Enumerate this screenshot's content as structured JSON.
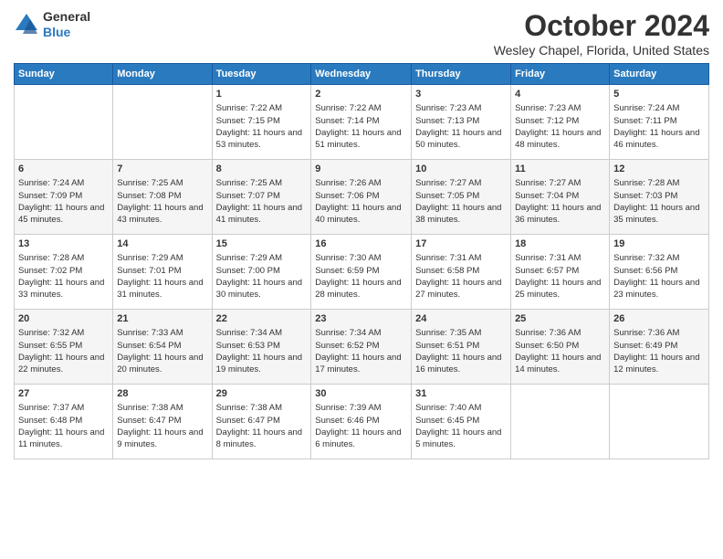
{
  "header": {
    "logo_line1": "General",
    "logo_line2": "Blue",
    "title": "October 2024",
    "location": "Wesley Chapel, Florida, United States"
  },
  "days_of_week": [
    "Sunday",
    "Monday",
    "Tuesday",
    "Wednesday",
    "Thursday",
    "Friday",
    "Saturday"
  ],
  "weeks": [
    [
      {
        "day": "",
        "data": ""
      },
      {
        "day": "",
        "data": ""
      },
      {
        "day": "1",
        "data": "Sunrise: 7:22 AM\nSunset: 7:15 PM\nDaylight: 11 hours and 53 minutes."
      },
      {
        "day": "2",
        "data": "Sunrise: 7:22 AM\nSunset: 7:14 PM\nDaylight: 11 hours and 51 minutes."
      },
      {
        "day": "3",
        "data": "Sunrise: 7:23 AM\nSunset: 7:13 PM\nDaylight: 11 hours and 50 minutes."
      },
      {
        "day": "4",
        "data": "Sunrise: 7:23 AM\nSunset: 7:12 PM\nDaylight: 11 hours and 48 minutes."
      },
      {
        "day": "5",
        "data": "Sunrise: 7:24 AM\nSunset: 7:11 PM\nDaylight: 11 hours and 46 minutes."
      }
    ],
    [
      {
        "day": "6",
        "data": "Sunrise: 7:24 AM\nSunset: 7:09 PM\nDaylight: 11 hours and 45 minutes."
      },
      {
        "day": "7",
        "data": "Sunrise: 7:25 AM\nSunset: 7:08 PM\nDaylight: 11 hours and 43 minutes."
      },
      {
        "day": "8",
        "data": "Sunrise: 7:25 AM\nSunset: 7:07 PM\nDaylight: 11 hours and 41 minutes."
      },
      {
        "day": "9",
        "data": "Sunrise: 7:26 AM\nSunset: 7:06 PM\nDaylight: 11 hours and 40 minutes."
      },
      {
        "day": "10",
        "data": "Sunrise: 7:27 AM\nSunset: 7:05 PM\nDaylight: 11 hours and 38 minutes."
      },
      {
        "day": "11",
        "data": "Sunrise: 7:27 AM\nSunset: 7:04 PM\nDaylight: 11 hours and 36 minutes."
      },
      {
        "day": "12",
        "data": "Sunrise: 7:28 AM\nSunset: 7:03 PM\nDaylight: 11 hours and 35 minutes."
      }
    ],
    [
      {
        "day": "13",
        "data": "Sunrise: 7:28 AM\nSunset: 7:02 PM\nDaylight: 11 hours and 33 minutes."
      },
      {
        "day": "14",
        "data": "Sunrise: 7:29 AM\nSunset: 7:01 PM\nDaylight: 11 hours and 31 minutes."
      },
      {
        "day": "15",
        "data": "Sunrise: 7:29 AM\nSunset: 7:00 PM\nDaylight: 11 hours and 30 minutes."
      },
      {
        "day": "16",
        "data": "Sunrise: 7:30 AM\nSunset: 6:59 PM\nDaylight: 11 hours and 28 minutes."
      },
      {
        "day": "17",
        "data": "Sunrise: 7:31 AM\nSunset: 6:58 PM\nDaylight: 11 hours and 27 minutes."
      },
      {
        "day": "18",
        "data": "Sunrise: 7:31 AM\nSunset: 6:57 PM\nDaylight: 11 hours and 25 minutes."
      },
      {
        "day": "19",
        "data": "Sunrise: 7:32 AM\nSunset: 6:56 PM\nDaylight: 11 hours and 23 minutes."
      }
    ],
    [
      {
        "day": "20",
        "data": "Sunrise: 7:32 AM\nSunset: 6:55 PM\nDaylight: 11 hours and 22 minutes."
      },
      {
        "day": "21",
        "data": "Sunrise: 7:33 AM\nSunset: 6:54 PM\nDaylight: 11 hours and 20 minutes."
      },
      {
        "day": "22",
        "data": "Sunrise: 7:34 AM\nSunset: 6:53 PM\nDaylight: 11 hours and 19 minutes."
      },
      {
        "day": "23",
        "data": "Sunrise: 7:34 AM\nSunset: 6:52 PM\nDaylight: 11 hours and 17 minutes."
      },
      {
        "day": "24",
        "data": "Sunrise: 7:35 AM\nSunset: 6:51 PM\nDaylight: 11 hours and 16 minutes."
      },
      {
        "day": "25",
        "data": "Sunrise: 7:36 AM\nSunset: 6:50 PM\nDaylight: 11 hours and 14 minutes."
      },
      {
        "day": "26",
        "data": "Sunrise: 7:36 AM\nSunset: 6:49 PM\nDaylight: 11 hours and 12 minutes."
      }
    ],
    [
      {
        "day": "27",
        "data": "Sunrise: 7:37 AM\nSunset: 6:48 PM\nDaylight: 11 hours and 11 minutes."
      },
      {
        "day": "28",
        "data": "Sunrise: 7:38 AM\nSunset: 6:47 PM\nDaylight: 11 hours and 9 minutes."
      },
      {
        "day": "29",
        "data": "Sunrise: 7:38 AM\nSunset: 6:47 PM\nDaylight: 11 hours and 8 minutes."
      },
      {
        "day": "30",
        "data": "Sunrise: 7:39 AM\nSunset: 6:46 PM\nDaylight: 11 hours and 6 minutes."
      },
      {
        "day": "31",
        "data": "Sunrise: 7:40 AM\nSunset: 6:45 PM\nDaylight: 11 hours and 5 minutes."
      },
      {
        "day": "",
        "data": ""
      },
      {
        "day": "",
        "data": ""
      }
    ]
  ]
}
